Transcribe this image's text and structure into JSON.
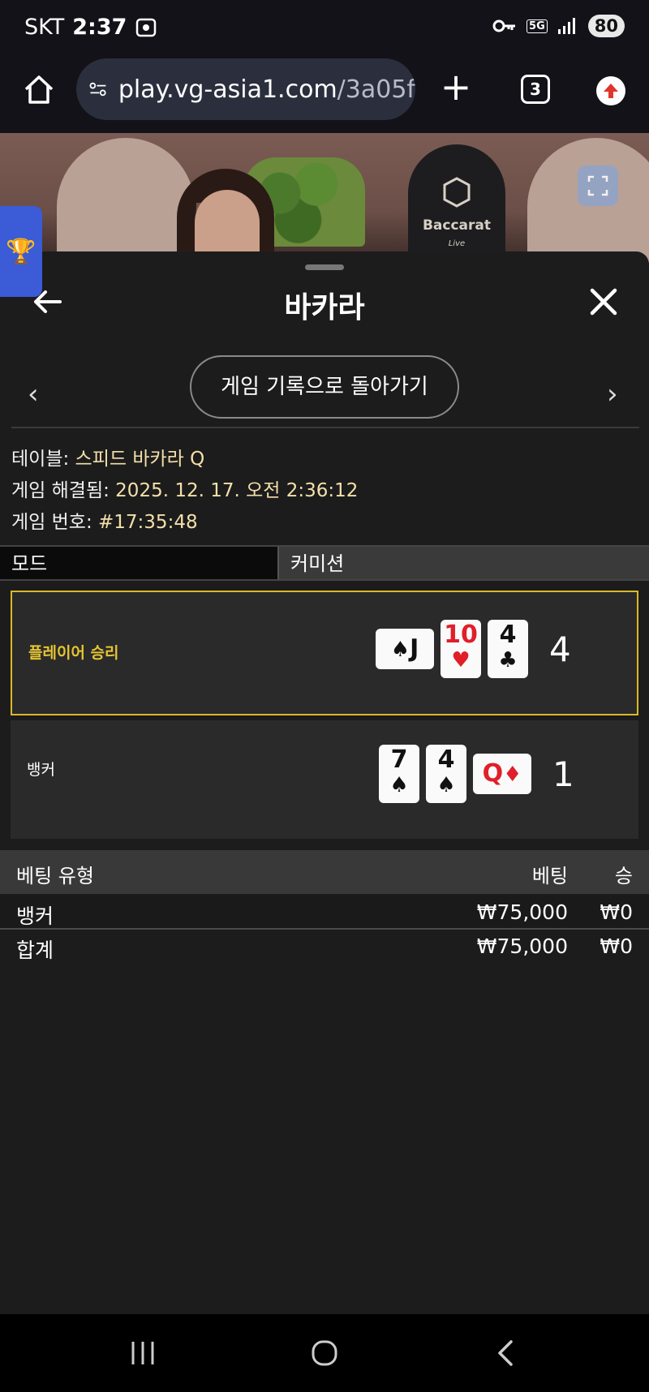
{
  "status": {
    "carrier": "SKT",
    "time": "2:37",
    "network": "5G",
    "battery": "80"
  },
  "browser": {
    "url_main": "play.vg-asia1.com",
    "url_path": "/3a05f",
    "tab_count": "3"
  },
  "video": {
    "logo_text": "Baccarat",
    "logo_sub": "Live"
  },
  "panel": {
    "title": "바카라",
    "history_button": "게임 기록으로 돌아가기",
    "info": {
      "table_label": "테이블: ",
      "table_value": "스피드 바카라 Q",
      "resolved_label": "게임 해결됨: ",
      "resolved_value": "2025. 12. 17. 오전 2:36:12",
      "number_label": "게임 번호: ",
      "number_value": "#17:35:48"
    },
    "mode": {
      "label": "모드",
      "value": "커미션"
    },
    "results": {
      "player": {
        "label": "플레이어 승리",
        "score": "4",
        "cards": [
          {
            "rank": "J",
            "suit": "♠",
            "color": "black",
            "orientation": "horizontal"
          },
          {
            "rank": "10",
            "suit": "♥",
            "color": "red",
            "orientation": "vertical"
          },
          {
            "rank": "4",
            "suit": "♣",
            "color": "black",
            "orientation": "vertical"
          }
        ]
      },
      "banker": {
        "label": "뱅커",
        "score": "1",
        "cards": [
          {
            "rank": "7",
            "suit": "♠",
            "color": "black",
            "orientation": "vertical"
          },
          {
            "rank": "4",
            "suit": "♠",
            "color": "black",
            "orientation": "vertical"
          },
          {
            "rank": "Q",
            "suit": "♦",
            "color": "red",
            "orientation": "horizontal"
          }
        ]
      }
    },
    "bets": {
      "headers": {
        "type": "베팅 유형",
        "bet": "베팅",
        "win": "승"
      },
      "rows": [
        {
          "type": "뱅커",
          "bet": "₩75,000",
          "win": "₩0"
        }
      ],
      "total": {
        "type": "합계",
        "bet": "₩75,000",
        "win": "₩0"
      }
    }
  },
  "colors": {
    "accent_gold": "#d9b928",
    "info_value": "#f3e0a9",
    "trophy_tab": "#3b5bd7"
  }
}
